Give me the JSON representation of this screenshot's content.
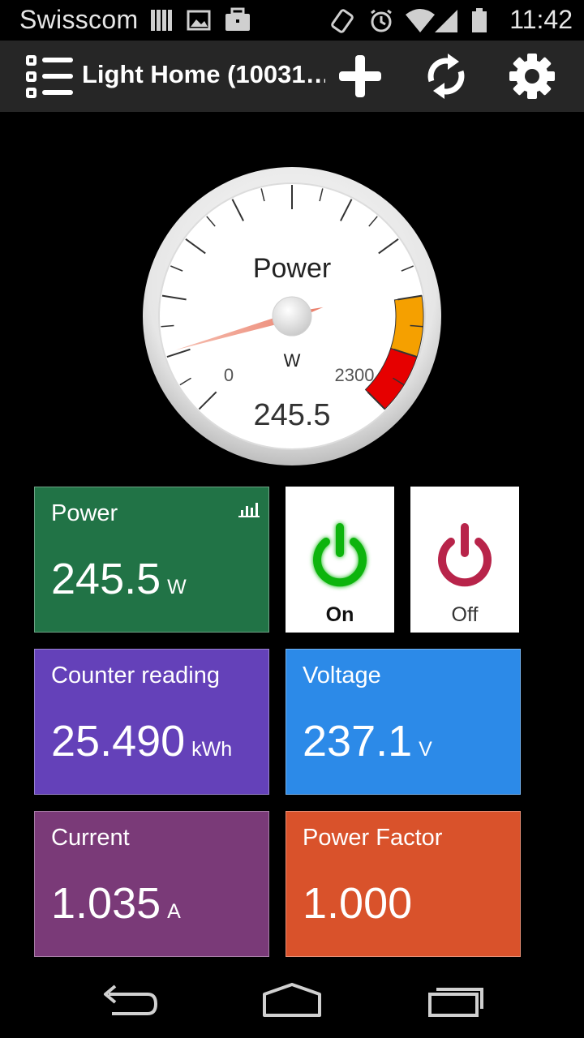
{
  "status_bar": {
    "carrier": "Swisscom",
    "time": "11:42",
    "left_icons": [
      "sim-bars-icon",
      "image-icon",
      "briefcase-icon"
    ],
    "right_icons": [
      "vibrate-icon",
      "alarm-icon",
      "wifi-icon",
      "signal-icon",
      "battery-icon"
    ]
  },
  "action_bar": {
    "title": "Light Home (10031…",
    "icons": [
      "list-menu-icon",
      "plus-icon",
      "refresh-icon",
      "gear-icon"
    ]
  },
  "gauge": {
    "title": "Power",
    "unit": "W",
    "min_label": "0",
    "max_label": "2300",
    "min": 0,
    "max": 2300,
    "value": 245.5,
    "value_text": "245.5",
    "zones": [
      {
        "from": 1840,
        "to": 2070,
        "color": "#f5a000"
      },
      {
        "from": 2070,
        "to": 2300,
        "color": "#e60000"
      }
    ]
  },
  "tiles": {
    "power": {
      "label": "Power",
      "value": "245.5",
      "unit": "W",
      "color": "#217346",
      "icon": "bar-chart-icon"
    },
    "counter": {
      "label": "Counter reading",
      "value": "25.490",
      "unit": "kWh",
      "color": "#6441b9"
    },
    "voltage": {
      "label": "Voltage",
      "value": "237.1",
      "unit": "V",
      "color": "#2c8ae8"
    },
    "current": {
      "label": "Current",
      "value": "1.035",
      "unit": "A",
      "color": "#7a3a78"
    },
    "power_factor": {
      "label": "Power Factor",
      "value": "1.000",
      "unit": "",
      "color": "#d9522b"
    }
  },
  "switches": {
    "on": {
      "label": "On",
      "color": "#0db40d",
      "icon": "power-icon"
    },
    "off": {
      "label": "Off",
      "color": "#b8244a",
      "icon": "power-icon"
    }
  },
  "nav_bar": {
    "icons": [
      "back-icon",
      "home-icon",
      "recent-apps-icon"
    ]
  }
}
